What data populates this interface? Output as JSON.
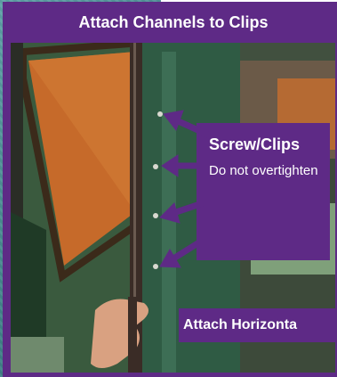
{
  "header": {
    "title": "Attach Channels to Clips"
  },
  "callout": {
    "title": "Screw/Clips",
    "body": "Do not overtighten"
  },
  "next_section": {
    "title": "Attach Horizonta"
  },
  "colors": {
    "accent_purple": "#5e2a86",
    "backdrop_teal": "#4f8d93",
    "text": "#ffffff"
  },
  "icons": [
    "arrow-icon"
  ]
}
